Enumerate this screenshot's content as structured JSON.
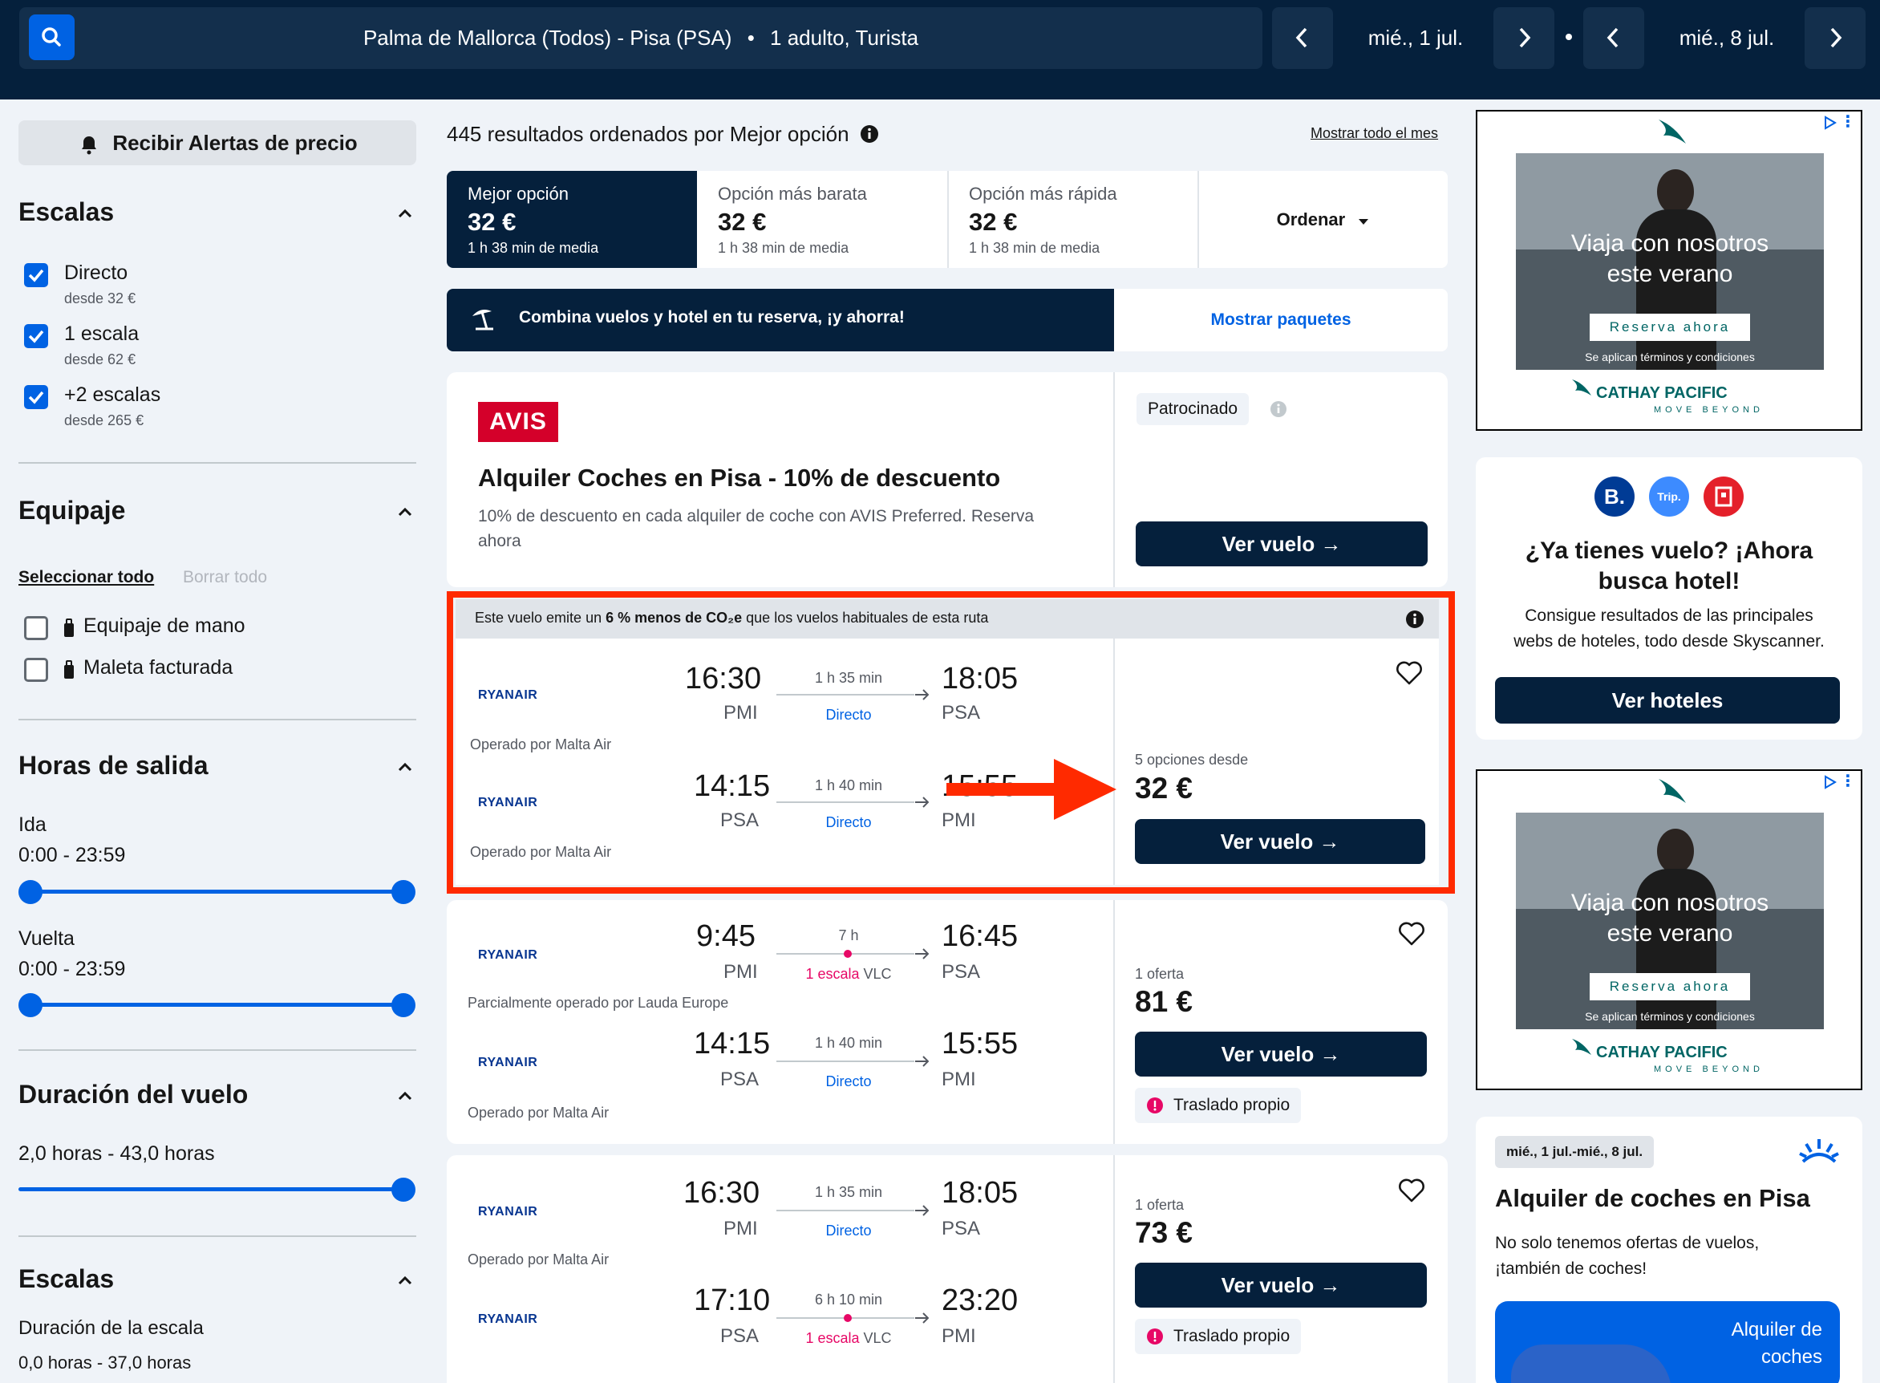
{
  "header": {
    "search_summary": "Palma de Mallorca (Todos) - Pisa (PSA)",
    "passengers": "1 adulto, Turista",
    "depart_date": "mié., 1 jul.",
    "return_date": "mié., 8 jul."
  },
  "sidebar": {
    "price_alert": "Recibir Alertas de precio",
    "stops_title": "Escalas",
    "stops": [
      {
        "label": "Directo",
        "sub": "desde 32 €",
        "checked": true
      },
      {
        "label": "1 escala",
        "sub": "desde 62 €",
        "checked": true
      },
      {
        "label": "+2 escalas",
        "sub": "desde 265 €",
        "checked": true
      }
    ],
    "baggage_title": "Equipaje",
    "select_all": "Seleccionar todo",
    "clear_all": "Borrar todo",
    "baggage": [
      {
        "label": "Equipaje de mano",
        "checked": false
      },
      {
        "label": "Maleta facturada",
        "checked": false
      }
    ],
    "times_title": "Horas de salida",
    "outbound_label": "Ida",
    "outbound_range": "0:00 - 23:59",
    "return_label": "Vuelta",
    "return_range": "0:00 - 23:59",
    "duration_title": "Duración del vuelo",
    "duration_range": "2,0 horas - 43,0 horas",
    "layover_title": "Escalas",
    "layover_label": "Duración de la escala",
    "layover_range": "0,0 horas - 37,0 horas"
  },
  "results": {
    "count_text": "445 resultados ordenados por Mejor opción",
    "show_month": "Mostrar todo el mes",
    "tabs": [
      {
        "title": "Mejor opción",
        "price": "32 €",
        "sub": "1 h 38 min de media"
      },
      {
        "title": "Opción más barata",
        "price": "32 €",
        "sub": "1 h 38 min de media"
      },
      {
        "title": "Opción más rápida",
        "price": "32 €",
        "sub": "1 h 38 min de media"
      }
    ],
    "sort_label": "Ordenar",
    "package_text": "Combina vuelos y hotel en tu reserva, ¡y ahorra!",
    "package_link": "Mostrar paquetes"
  },
  "sponsored": {
    "logo": "AVIS",
    "title": "Alquiler Coches en Pisa - 10% de descuento",
    "desc_line1": "10% de descuento en cada alquiler de coche con AVIS Preferred. Reserva",
    "desc_line2": "ahora",
    "badge": "Patrocinado",
    "button": "Ver vuelo →"
  },
  "eco_banner": {
    "pre": "Este vuelo emite un ",
    "bold": "6 % menos de CO₂e",
    "post": " que los vuelos habituales de esta ruta"
  },
  "flights": [
    {
      "legs": [
        {
          "airline": "RYANAIR",
          "dep": "16:30",
          "from": "PMI",
          "duration": "1 h 35 min",
          "stops": "Directo",
          "arr": "18:05",
          "to": "PSA",
          "operator": "Operado por Malta Air"
        },
        {
          "airline": "RYANAIR",
          "dep": "14:15",
          "from": "PSA",
          "duration": "1 h 40 min",
          "stops": "Directo",
          "arr": "15:55",
          "to": "PMI",
          "operator": "Operado por Malta Air"
        }
      ],
      "offers": "5 opciones desde",
      "price": "32 €",
      "button": "Ver vuelo →"
    },
    {
      "legs": [
        {
          "airline": "RYANAIR",
          "dep": "9:45",
          "from": "PMI",
          "duration": "7 h",
          "stops": "1 escala",
          "via": "VLC",
          "arr": "16:45",
          "to": "PSA",
          "operator": "Parcialmente operado por Lauda Europe"
        },
        {
          "airline": "RYANAIR",
          "dep": "14:15",
          "from": "PSA",
          "duration": "1 h 40 min",
          "stops": "Directo",
          "arr": "15:55",
          "to": "PMI",
          "operator": "Operado por Malta Air"
        }
      ],
      "offers": "1 oferta",
      "price": "81 €",
      "button": "Ver vuelo →",
      "warning": "Traslado propio"
    },
    {
      "legs": [
        {
          "airline": "RYANAIR",
          "dep": "16:30",
          "from": "PMI",
          "duration": "1 h 35 min",
          "stops": "Directo",
          "arr": "18:05",
          "to": "PSA",
          "operator": "Operado por Malta Air"
        },
        {
          "airline": "RYANAIR",
          "dep": "17:10",
          "from": "PSA",
          "duration": "6 h 10 min",
          "stops": "1 escala",
          "via": "VLC",
          "arr": "23:20",
          "to": "PMI"
        }
      ],
      "offers": "1 oferta",
      "price": "73 €",
      "button": "Ver vuelo →",
      "warning": "Traslado propio"
    }
  ],
  "ads": {
    "cathay_headline1": "Viaja con nosotros",
    "cathay_headline2": "este verano",
    "cathay_cta": "Reserva ahora",
    "cathay_terms": "Se aplican términos y condiciones",
    "cathay_brand": "CATHAY PACIFIC",
    "cathay_tagline": "MOVE BEYOND",
    "hotel_logos": [
      "B.",
      "Trip."
    ],
    "hotel_title1": "¿Ya tienes vuelo? ¡Ahora",
    "hotel_title2": "busca hotel!",
    "hotel_desc1": "Consigue resultados de las principales",
    "hotel_desc2": "webs de hoteles, todo desde Skyscanner.",
    "hotel_button": "Ver hoteles",
    "car_dates": "mié., 1 jul.-mié., 8 jul.",
    "car_title": "Alquiler de coches en Pisa",
    "car_desc1": "No solo tenemos ofertas de vuelos,",
    "car_desc2": "¡también de coches!",
    "car_banner1": "Alquiler de",
    "car_banner2": "coches"
  },
  "colors": {
    "navy": "#05203c",
    "blue": "#0062e3",
    "highlight": "#ff2a00",
    "pink": "#e70866"
  }
}
